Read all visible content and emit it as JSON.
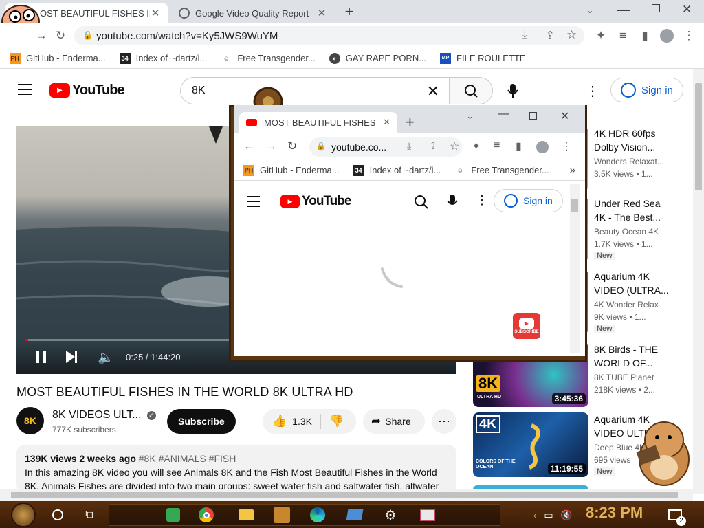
{
  "browser": {
    "tabs": [
      {
        "title": "MOST BEAUTIFUL FISHES IN THE WORLD 8K ULTRA HD",
        "display": "OST BEAUTIFUL FISHES IN"
      },
      {
        "title": "Google Video Quality Report"
      }
    ],
    "url": "youtube.com/watch?v=Ky5JWS9WuYM",
    "bookmarks": [
      "GitHub - Enderma...",
      "Index of ~dartz/i...",
      "Free Transgender...",
      "GAY RAPE PORN...",
      "FILE ROULETTE"
    ],
    "bookmark_icons": [
      "PH",
      "34",
      "",
      "",
      "MP"
    ]
  },
  "youtube": {
    "logo": "YouTube",
    "search_value": "8K",
    "signin": "Sign in",
    "player": {
      "time": "0:25 / 1:44:20",
      "progress": 0.004
    },
    "title": "MOST BEAUTIFUL FISHES IN THE WORLD 8K ULTRA HD",
    "channel": {
      "name": "8K VIDEOS ULT...",
      "subs": "777K subscribers",
      "avatar": "8K"
    },
    "subscribe": "Subscribe",
    "likes": "1.3K",
    "share": "Share",
    "description": {
      "meta": "139K views  2 weeks ago",
      "tags": "#8K #ANIMALS #FISH",
      "text": "In this amazing 8K video you will see Animals 8K and the Fish Most Beautiful Fishes in the World 8K. Animals Fishes are divided into two main groups: sweet water fish and saltwater fish, altwater"
    },
    "sidebar": [
      {
        "title": "4K HDR 60fps Dolby Vision...",
        "channel": "Wonders Relaxat...",
        "meta": "3.5K views  • 1..."
      },
      {
        "title": "Under Red Sea 4K - The Best...",
        "channel": "Beauty Ocean 4K",
        "meta": "1.7K views  • 1...",
        "badge": "New"
      },
      {
        "title": "Aquarium 4K VIDEO (ULTRA...",
        "channel": "4K Wonder Relax",
        "meta": "9K views  • 1...",
        "badge": "New"
      },
      {
        "title": "8K Birds - THE WORLD OF...",
        "channel": "8K TUBE Planet",
        "meta": "218K views  • 2...",
        "duration": "3:45:36",
        "thumb_text": "8K",
        "thumb_sub": "ULTRA HD"
      },
      {
        "title": "Aquarium 4K VIDEO ULTRA...",
        "channel": "Deep Blue 4K",
        "meta": "695 views",
        "duration": "11:19:55",
        "badge": "New",
        "thumb_text": "4K",
        "thumb_sub": "COLORS OF THE OCEAN"
      }
    ]
  },
  "popup": {
    "tab_title": "MOST BEAUTIFUL FISHES IN THE WORLD",
    "url": "youtube.co...",
    "bookmarks": [
      "GitHub - Enderma...",
      "Index of ~dartz/i...",
      "Free Transgender..."
    ],
    "logo": "YouTube",
    "signin": "Sign in",
    "subscribe_icon": "SUBSCRIBE"
  },
  "taskbar": {
    "clock": "8:23 PM",
    "notif": "2"
  },
  "colors": {
    "yt_red": "#ff0000",
    "link_blue": "#065fd4",
    "taskbar": "#4a250a",
    "clock": "#e0b25a"
  }
}
